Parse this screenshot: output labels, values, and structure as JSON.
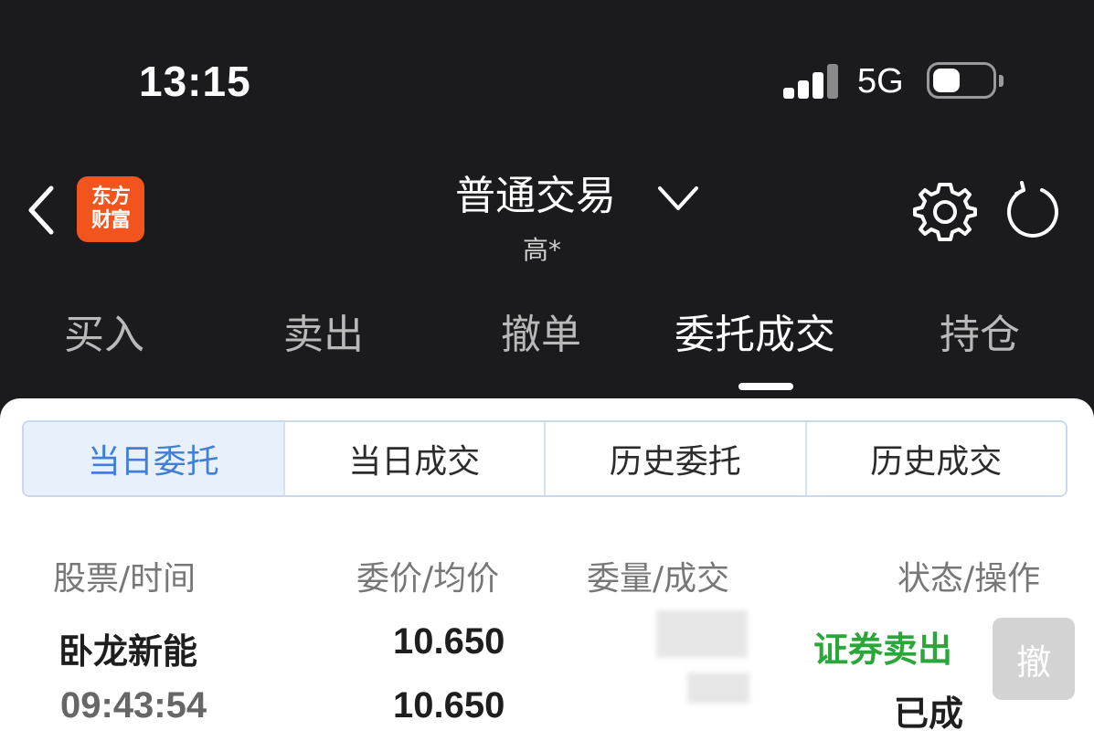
{
  "status_bar": {
    "time": "13:15",
    "network": "5G",
    "battery_level": 0.45
  },
  "header": {
    "logo_line1": "东方",
    "logo_line2": "财富",
    "title": "普通交易",
    "subtitle": "高*"
  },
  "main_tabs": [
    {
      "label": "买入"
    },
    {
      "label": "卖出"
    },
    {
      "label": "撤单"
    },
    {
      "label": "委托成交"
    },
    {
      "label": "持仓"
    }
  ],
  "active_main_tab": "委托成交",
  "sub_tabs": [
    {
      "label": "当日委托"
    },
    {
      "label": "当日成交"
    },
    {
      "label": "历史委托"
    },
    {
      "label": "历史成交"
    }
  ],
  "active_sub_tab": "当日委托",
  "table": {
    "headers": [
      "股票/时间",
      "委价/均价",
      "委量/成交",
      "状态/操作"
    ],
    "rows": [
      {
        "stock": "卧龙新能",
        "time": "09:43:54",
        "order_price": "10.650",
        "avg_price": "10.650",
        "status_type": "证券卖出",
        "status": "已成",
        "action": "撤"
      }
    ]
  },
  "colors": {
    "background": "#1b1b1d",
    "brand": "#f2541e",
    "active_tab_text": "#3f7fd6",
    "sell_green": "#2aa63a"
  }
}
